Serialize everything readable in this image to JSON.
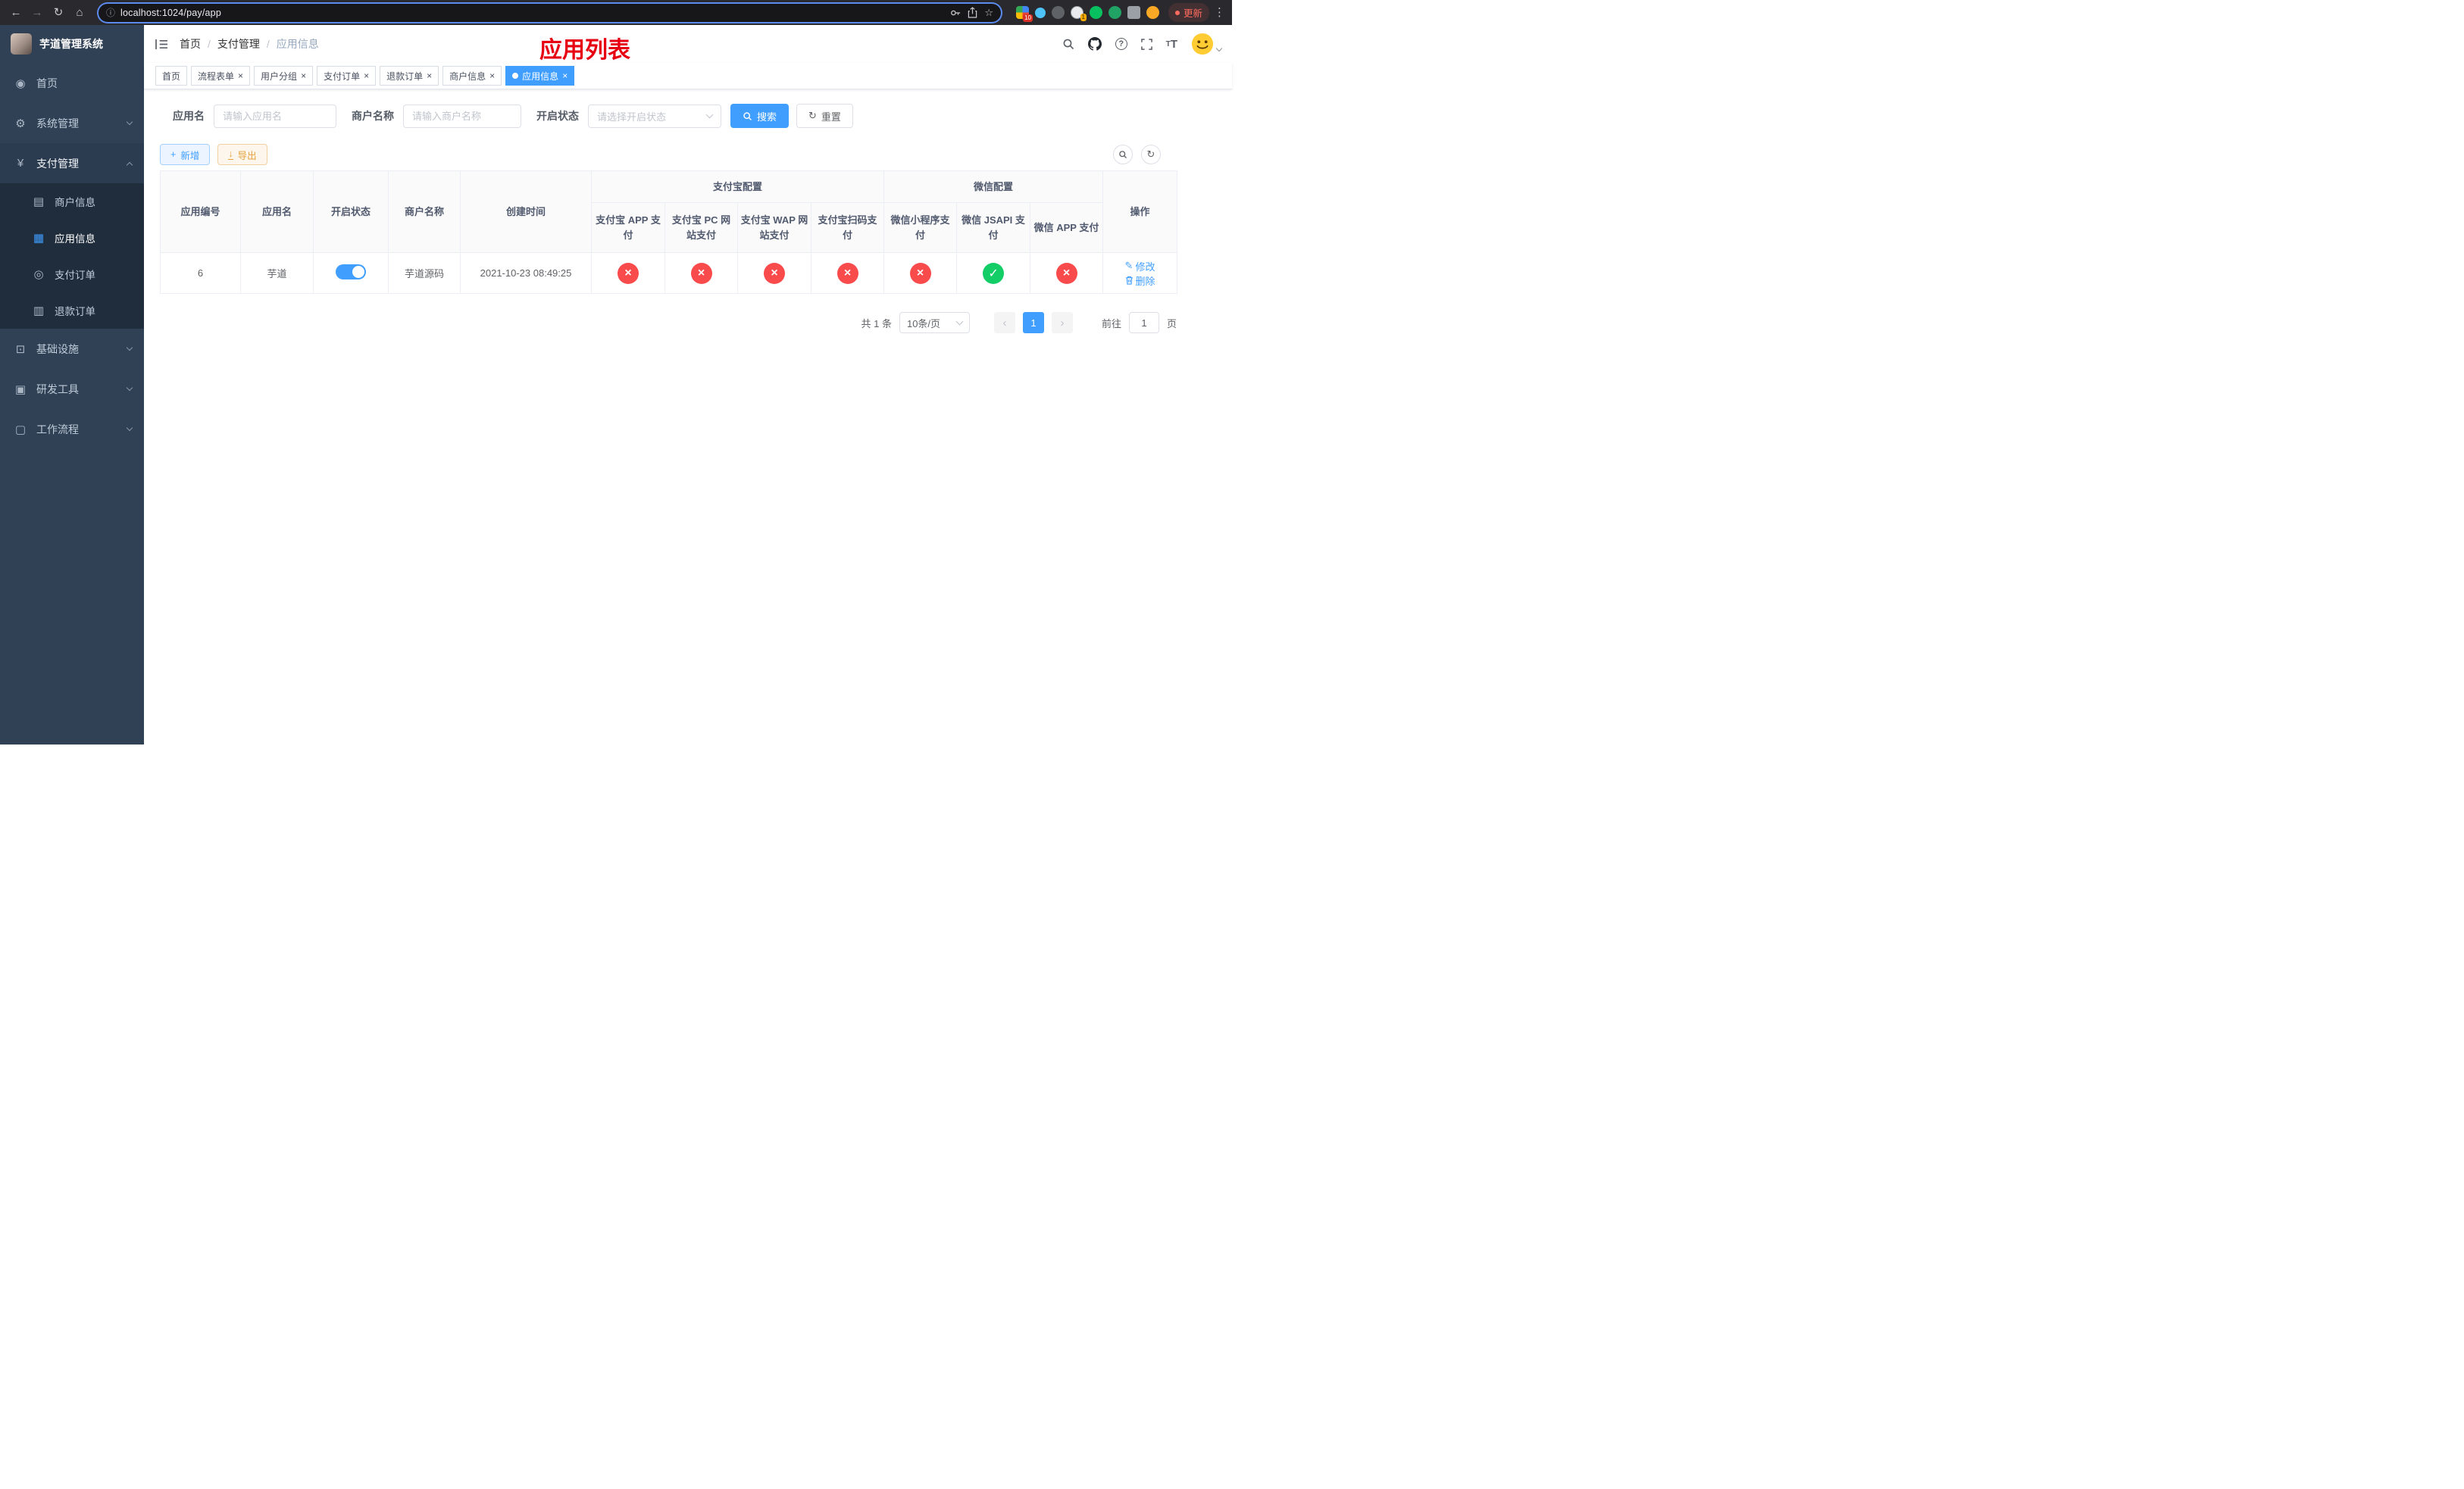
{
  "browser": {
    "url": "localhost:1024/pay/app",
    "update_label": "更新",
    "ext_badge_puzzle": "10",
    "ext_badge_avatar": "1"
  },
  "icons": {
    "back": "←",
    "forward": "→",
    "reload": "↻",
    "home": "⌂",
    "info": "ⓘ",
    "star": "☆",
    "menu_dots": "⋮",
    "dashboard": "◉",
    "gear": "⚙",
    "yen": "¥",
    "card": "▤",
    "grid": "▦",
    "order": "◎",
    "refund": "▥",
    "infra": "⊡",
    "tools": "▣",
    "workflow": "▢",
    "close": "×",
    "plus": "+",
    "download": "↓",
    "refresh": "↻",
    "prev": "‹",
    "next": "›",
    "edit": "✎",
    "fontsize_big": "T",
    "fontsize_small": "T"
  },
  "colors": {
    "accent": "#409eff",
    "sidebar_bg": "#304156",
    "submenu_bg": "#1f2d3d",
    "danger": "#f94b4b",
    "success": "#13ce66",
    "warning": "#e6a23c",
    "overlay_red": "#e60012",
    "tab_active": "#409eff"
  },
  "sidebar": {
    "title": "芋道管理系统",
    "home": "首页",
    "system": "系统管理",
    "payment": "支付管理",
    "merchant": "商户信息",
    "app_info": "应用信息",
    "pay_order": "支付订单",
    "refund_order": "退款订单",
    "infra": "基础设施",
    "dev_tools": "研发工具",
    "workflow": "工作流程"
  },
  "header": {
    "breadcrumb": [
      "首页",
      "支付管理",
      "应用信息"
    ],
    "overlay_title": "应用列表"
  },
  "tabs": [
    {
      "label": "首页",
      "closable": false,
      "active": false
    },
    {
      "label": "流程表单",
      "closable": true,
      "active": false
    },
    {
      "label": "用户分组",
      "closable": true,
      "active": false
    },
    {
      "label": "支付订单",
      "closable": true,
      "active": false
    },
    {
      "label": "退款订单",
      "closable": true,
      "active": false
    },
    {
      "label": "商户信息",
      "closable": true,
      "active": false
    },
    {
      "label": "应用信息",
      "closable": true,
      "active": true
    }
  ],
  "filters": {
    "app_name_label": "应用名",
    "app_name_placeholder": "请输入应用名",
    "merchant_label": "商户名称",
    "merchant_placeholder": "请输入商户名称",
    "status_label": "开启状态",
    "status_placeholder": "请选择开启状态",
    "search_label": "搜索",
    "reset_label": "重置"
  },
  "toolbar": {
    "add_label": "新增",
    "export_label": "导出"
  },
  "table": {
    "group_alipay": "支付宝配置",
    "group_wechat": "微信配置",
    "col_id": "应用编号",
    "col_name": "应用名",
    "col_status": "开启状态",
    "col_merchant": "商户名称",
    "col_created": "创建时间",
    "col_alipay_app": "支付宝 APP 支付",
    "col_alipay_pc": "支付宝 PC 网站支付",
    "col_alipay_wap": "支付宝 WAP 网站支付",
    "col_alipay_qr": "支付宝扫码支付",
    "col_wx_lite": "微信小程序支付",
    "col_wx_jsapi": "微信 JSAPI 支付",
    "col_wx_app": "微信 APP 支付",
    "col_op": "操作",
    "row": {
      "id": "6",
      "name": "芋道",
      "enabled": true,
      "merchant": "芋道源码",
      "created": "2021-10-23 08:49:25",
      "channels": {
        "alipay_app": false,
        "alipay_pc": false,
        "alipay_wap": false,
        "alipay_qr": false,
        "wx_lite": false,
        "wx_jsapi": true,
        "wx_app": false
      },
      "op_edit": "修改",
      "op_delete": "删除"
    }
  },
  "pagination": {
    "total": "共 1 条",
    "page_size": "10条/页",
    "page": "1",
    "goto_label": "前往",
    "goto_value": "1",
    "goto_suffix": "页"
  }
}
